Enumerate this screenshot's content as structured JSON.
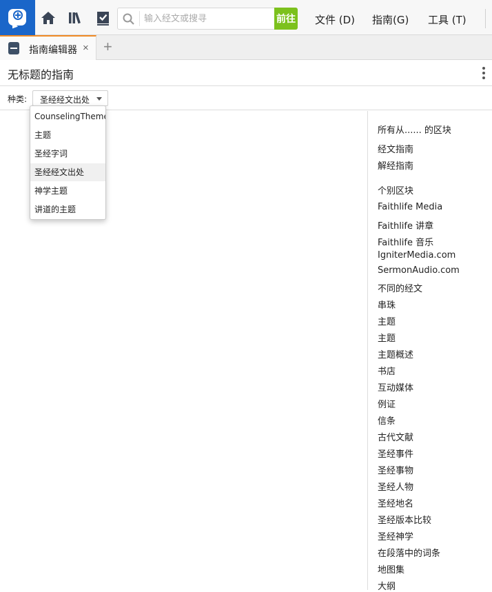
{
  "toolbar": {
    "search_placeholder": "输入经文或搜寻",
    "go_label": "前往",
    "menus": [
      {
        "label": "文件 (D)"
      },
      {
        "label": "指南(G)"
      },
      {
        "label": "工具 (T)"
      }
    ]
  },
  "tab": {
    "label": "指南编辑器",
    "close": "×",
    "add": "+"
  },
  "page": {
    "title": "无标题的指南"
  },
  "type_row": {
    "label": "种类:",
    "selected": "圣经经文出处"
  },
  "dropdown": {
    "options": [
      {
        "label": "CounselingTheme"
      },
      {
        "label": "主题"
      },
      {
        "label": "圣经字词"
      },
      {
        "label": "圣经经文出处",
        "selected": true
      },
      {
        "label": "神学主题"
      },
      {
        "label": "讲道的主题"
      }
    ]
  },
  "panel": {
    "all_heading": "所有从...... 的区块",
    "guides": [
      "经文指南",
      "解经指南"
    ],
    "individual_heading": "个别区块",
    "sections": [
      "Faithlife Media",
      "Faithlife 讲章",
      "Faithlife 音乐",
      "IgniterMedia.com",
      "SermonAudio.com",
      "不同的经文",
      "串珠",
      "主题",
      "主题",
      "主题概述",
      "书店",
      "互动媒体",
      "例证",
      "信条",
      "古代文献",
      "圣经事件",
      "圣经事物",
      "圣经人物",
      "圣经地名",
      "圣经版本比较",
      "圣经神学",
      "在段落中的词条",
      "地图集",
      "大纲"
    ]
  },
  "colors": {
    "accent": "#1a66c9",
    "go": "#7cc11d",
    "tab_accent": "#f08a24"
  }
}
